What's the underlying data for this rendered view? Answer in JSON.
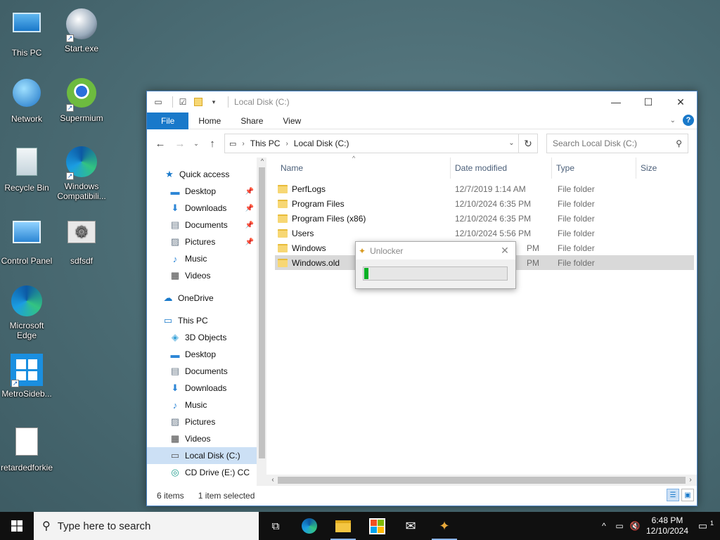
{
  "desktop": {
    "icons": [
      {
        "label": "This PC",
        "icon": "this-pc-icon"
      },
      {
        "label": "Start.exe",
        "icon": "start-exe-icon"
      },
      {
        "label": "Network",
        "icon": "network-icon"
      },
      {
        "label": "Supermium",
        "icon": "supermium-icon"
      },
      {
        "label": "Recycle Bin",
        "icon": "recycle-bin-icon"
      },
      {
        "label": "Windows Compatibili...",
        "icon": "edge-compat-icon"
      },
      {
        "label": "Control Panel",
        "icon": "control-panel-icon"
      },
      {
        "label": "sdfsdf",
        "icon": "settings-file-icon"
      },
      {
        "label": "Microsoft Edge",
        "icon": "edge-icon"
      },
      {
        "label": "MetroSideb...",
        "icon": "metro-sidebar-icon"
      },
      {
        "label": "retardedforkie",
        "icon": "text-file-icon"
      }
    ]
  },
  "explorer": {
    "title": "Local Disk (C:)",
    "ribbon_tabs": [
      "File",
      "Home",
      "Share",
      "View"
    ],
    "address": [
      "This PC",
      "Local Disk (C:)"
    ],
    "search_placeholder": "Search Local Disk (C:)",
    "nav": {
      "quick_access": "Quick access",
      "quick_items": [
        "Desktop",
        "Downloads",
        "Documents",
        "Pictures",
        "Music",
        "Videos"
      ],
      "onedrive": "OneDrive",
      "this_pc": "This PC",
      "pc_items": [
        "3D Objects",
        "Desktop",
        "Documents",
        "Downloads",
        "Music",
        "Pictures",
        "Videos",
        "Local Disk (C:)",
        "CD Drive (E:) CC"
      ]
    },
    "columns": [
      "Name",
      "Date modified",
      "Type",
      "Size"
    ],
    "files": [
      {
        "name": "PerfLogs",
        "date": "12/7/2019 1:14 AM",
        "type": "File folder"
      },
      {
        "name": "Program Files",
        "date": "12/10/2024 6:35 PM",
        "type": "File folder"
      },
      {
        "name": "Program Files (x86)",
        "date": "12/10/2024 6:35 PM",
        "type": "File folder"
      },
      {
        "name": "Users",
        "date": "12/10/2024 5:56 PM",
        "type": "File folder"
      },
      {
        "name": "Windows",
        "date": "PM",
        "type": "File folder"
      },
      {
        "name": "Windows.old",
        "date": "PM",
        "type": "File folder"
      }
    ],
    "status": {
      "items": "6 items",
      "selected": "1 item selected"
    }
  },
  "dialog": {
    "title": "Unlocker",
    "progress": 0.03
  },
  "taskbar": {
    "search_placeholder": "Type here to search",
    "time": "6:48 PM",
    "date": "12/10/2024",
    "notification_count": "1"
  }
}
